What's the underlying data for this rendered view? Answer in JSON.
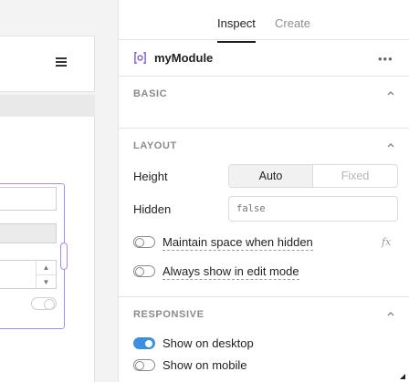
{
  "tabs": [
    {
      "label": "Inspect",
      "active": true
    },
    {
      "label": "Create",
      "active": false
    }
  ],
  "module": {
    "name": "myModule",
    "icon": "module-icon",
    "more_icon": "more-horizontal-icon"
  },
  "sections": {
    "basic": {
      "title": "BASIC",
      "collapsed": false
    },
    "layout": {
      "title": "LAYOUT",
      "height": {
        "label": "Height",
        "options": [
          "Auto",
          "Fixed"
        ],
        "selected": "Auto"
      },
      "hidden": {
        "label": "Hidden",
        "placeholder": "false",
        "value": ""
      },
      "maintain_space": {
        "label": "Maintain space when hidden",
        "checked": false
      },
      "always_show": {
        "label": "Always show in edit mode",
        "checked": false
      },
      "fx_label": "fx"
    },
    "responsive": {
      "title": "RESPONSIVE",
      "desktop": {
        "label": "Show on desktop",
        "checked": true
      },
      "mobile": {
        "label": "Show on mobile",
        "checked": false
      }
    }
  },
  "colors": {
    "accent": "#3d8fe0",
    "selection": "#a88cf2",
    "module_icon": "#7b5bd6"
  }
}
